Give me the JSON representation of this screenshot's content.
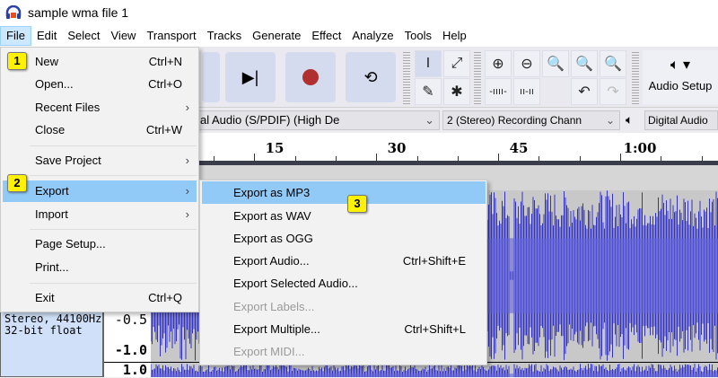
{
  "window": {
    "title": "sample wma file 1",
    "app_icon": "audacity-headphones-icon"
  },
  "menubar": [
    "File",
    "Edit",
    "Select",
    "View",
    "Transport",
    "Tracks",
    "Generate",
    "Effect",
    "Analyze",
    "Tools",
    "Help"
  ],
  "toolbar": {
    "audio_setup": "Audio Setup"
  },
  "devices": {
    "playback_device": "al Audio (S/PDIF) (High De",
    "channels": "2 (Stereo) Recording Chann",
    "output_device": "Digital Audio"
  },
  "ruler": {
    "labels": [
      "15",
      "30",
      "45",
      "1:00"
    ]
  },
  "track": {
    "info_line1": "Stereo, 44100Hz",
    "info_line2": "32-bit float",
    "scale": [
      "-0.5",
      "-1.0",
      "1.0"
    ]
  },
  "file_menu": [
    {
      "label": "New",
      "shortcut": "Ctrl+N"
    },
    {
      "label": "Open...",
      "shortcut": "Ctrl+O"
    },
    {
      "label": "Recent Files",
      "submenu": true
    },
    {
      "label": "Close",
      "shortcut": "Ctrl+W"
    },
    {
      "label": "Save Project",
      "submenu": true
    },
    {
      "label": "Export",
      "submenu": true,
      "highlighted": true
    },
    {
      "label": "Import",
      "submenu": true
    },
    {
      "label": "Page Setup..."
    },
    {
      "label": "Print..."
    },
    {
      "label": "Exit",
      "shortcut": "Ctrl+Q"
    }
  ],
  "export_menu": [
    {
      "label": "Export as MP3",
      "highlighted": true
    },
    {
      "label": "Export as WAV"
    },
    {
      "label": "Export as OGG"
    },
    {
      "label": "Export Audio...",
      "shortcut": "Ctrl+Shift+E"
    },
    {
      "label": "Export Selected Audio..."
    },
    {
      "label": "Export Labels...",
      "disabled": true
    },
    {
      "label": "Export Multiple...",
      "shortcut": "Ctrl+Shift+L"
    },
    {
      "label": "Export MIDI...",
      "disabled": true
    }
  ],
  "step_badges": [
    "1",
    "2",
    "3"
  ],
  "colors": {
    "highlight": "#91c9f7",
    "waveform": "#3232c8",
    "badge": "#fff200",
    "record": "#b03030"
  }
}
